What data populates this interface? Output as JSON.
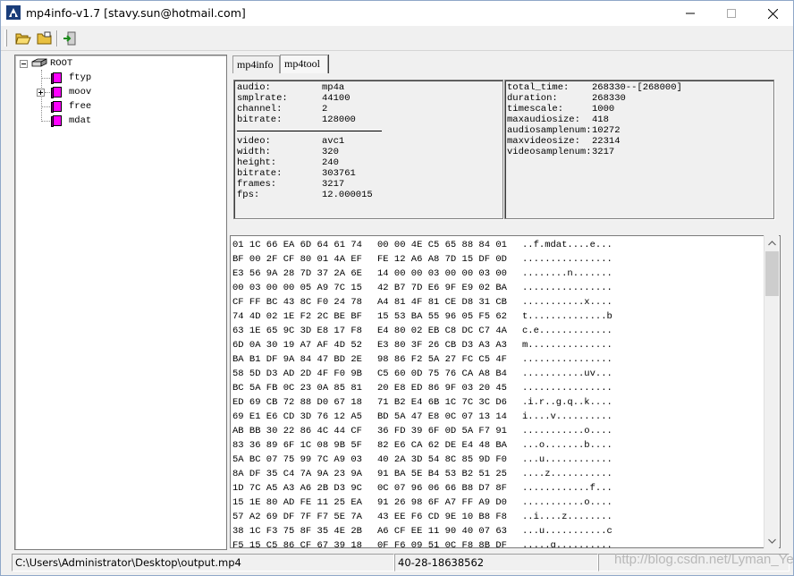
{
  "window": {
    "title": "mp4info-v1.7 [stavy.sun@hotmail.com]",
    "minimize_glyph": "—",
    "maximize_glyph": "☐",
    "close_glyph": "✕"
  },
  "toolbar": {
    "items": [
      {
        "name": "open-folder-icon"
      },
      {
        "name": "folder-icon"
      },
      {
        "name": "exit-icon"
      }
    ]
  },
  "tree": {
    "root_label": "ROOT",
    "children": [
      {
        "label": "ftyp",
        "expandable": false
      },
      {
        "label": "moov",
        "expandable": true
      },
      {
        "label": "free",
        "expandable": false
      },
      {
        "label": "mdat",
        "expandable": false
      }
    ]
  },
  "tabs": [
    {
      "label": "mp4info",
      "active": false
    },
    {
      "label": "mp4tool",
      "active": true
    }
  ],
  "info_left": {
    "audio": [
      {
        "key": "audio:",
        "value": "mp4a"
      },
      {
        "key": "smplrate:",
        "value": "44100"
      },
      {
        "key": "channel:",
        "value": "2"
      },
      {
        "key": "bitrate:",
        "value": "128000"
      }
    ],
    "video": [
      {
        "key": "video:",
        "value": "avc1"
      },
      {
        "key": "width:",
        "value": "320"
      },
      {
        "key": "height:",
        "value": "240"
      },
      {
        "key": "bitrate:",
        "value": "303761"
      },
      {
        "key": "frames:",
        "value": "3217"
      },
      {
        "key": "fps:",
        "value": "12.000015"
      }
    ]
  },
  "info_right": [
    {
      "key": "total_time:",
      "value": "268330--[268000]"
    },
    {
      "key": "duration:",
      "value": "268330"
    },
    {
      "key": "timescale:",
      "value": "1000"
    },
    {
      "key": "maxaudiosize:",
      "value": "418"
    },
    {
      "key": "audiosamplenum:",
      "value": "10272"
    },
    {
      "key": "maxvideosize:",
      "value": "22314"
    },
    {
      "key": "videosamplenum:",
      "value": "3217"
    }
  ],
  "hex_rows": [
    {
      "a": "01 1C 66 EA 6D 64 61 74",
      "b": "00 00 4E C5 65 88 84 01",
      "c": "..f.mdat....e..."
    },
    {
      "a": "BF 00 2F CF 80 01 4A EF",
      "b": "FE 12 A6 A8 7D 15 DF 0D",
      "c": "................"
    },
    {
      "a": "E3 56 9A 28 7D 37 2A 6E",
      "b": "14 00 00 03 00 00 03 00",
      "c": "........n......."
    },
    {
      "a": "00 03 00 00 05 A9 7C 15",
      "b": "42 B7 7D E6 9F E9 02 BA",
      "c": "................"
    },
    {
      "a": "CF FF BC 43 8C F0 24 78",
      "b": "A4 81 4F 81 CE D8 31 CB",
      "c": "...........x...."
    },
    {
      "a": "74 4D 02 1E F2 2C BE BF",
      "b": "15 53 BA 55 96 05 F5 62",
      "c": "t..............b"
    },
    {
      "a": "63 1E 65 9C 3D E8 17 F8",
      "b": "E4 80 02 EB C8 DC C7 4A",
      "c": "c.e............."
    },
    {
      "a": "6D 0A 30 19 A7 AF 4D 52",
      "b": "E3 80 3F 26 CB D3 A3 A3",
      "c": "m..............."
    },
    {
      "a": "BA B1 DF 9A 84 47 BD 2E",
      "b": "98 86 F2 5A 27 FC C5 4F",
      "c": "................"
    },
    {
      "a": "58 5D D3 AD 2D 4F F0 9B",
      "b": "C5 60 0D 75 76 CA A8 B4",
      "c": "...........uv..."
    },
    {
      "a": "BC 5A FB 0C 23 0A 85 81",
      "b": "20 E8 ED 86 9F 03 20 45",
      "c": "................"
    },
    {
      "a": "ED 69 CB 72 88 D0 67 18",
      "b": "71 B2 E4 6B 1C 7C 3C D6",
      "c": ".i.r..g.q..k...."
    },
    {
      "a": "69 E1 E6 CD 3D 76 12 A5",
      "b": "BD 5A 47 E8 0C 07 13 14",
      "c": "i....v.........."
    },
    {
      "a": "AB BB 30 22 86 4C 44 CF",
      "b": "36 FD 39 6F 0D 5A F7 91",
      "c": "...........o...."
    },
    {
      "a": "83 36 89 6F 1C 08 9B 5F",
      "b": "82 E6 CA 62 DE E4 48 BA",
      "c": "...o.......b...."
    },
    {
      "a": "5A BC 07 75 99 7C A9 03",
      "b": "40 2A 3D 54 8C 85 9D F0",
      "c": "...u............"
    },
    {
      "a": "8A DF 35 C4 7A 9A 23 9A",
      "b": "91 BA 5E B4 53 B2 51 25",
      "c": "....z..........."
    },
    {
      "a": "1D 7C A5 A3 A6 2B D3 9C",
      "c": "............f...",
      "b": "0C 07 96 06 66 B8 D7 8F"
    },
    {
      "a": "15 1E 80 AD FE 11 25 EA",
      "b": "91 26 98 6F A7 FF A9 D0",
      "c": "...........o...."
    },
    {
      "a": "57 A2 69 DF 7F F7 5E 7A",
      "b": "43 EE F6 CD 9E 10 B8 F8",
      "c": "..i....z........"
    },
    {
      "a": "38 1C F3 75 8F 35 4E 2B",
      "b": "A6 CF EE 11 90 40 07 63",
      "c": "...u...........c"
    },
    {
      "a": "F5 15 C5 86 CF 67 39 18",
      "b": "0F F6 09 51 0C F8 8B DF",
      "c": ".....g.........."
    }
  ],
  "status": {
    "path": "C:\\Users\\Administrator\\Desktop\\output.mp4",
    "offset": "40-28-18638562",
    "watermark": "http://blog.csdn.net/Lyman_Ye"
  }
}
